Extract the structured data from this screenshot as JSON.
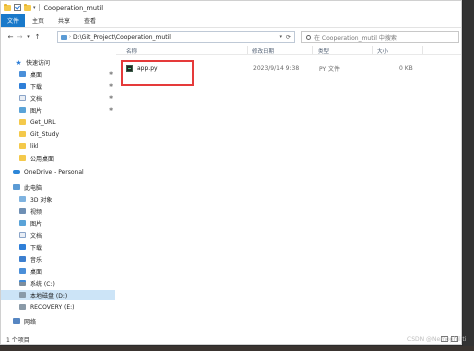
{
  "window": {
    "title": "Cooperation_mutil"
  },
  "ribbon": {
    "tabs": [
      "文件",
      "主页",
      "共享",
      "查看"
    ]
  },
  "address": {
    "path": "D:\\Git_Project\\Cooperation_mutil",
    "search_placeholder": "在 Cooperation_mutil 中搜索"
  },
  "nav": {
    "quick_access": "快速访问",
    "quick_items": [
      "桌面",
      "下载",
      "文档",
      "图片",
      "Get_URL",
      "Git_Study",
      "likl",
      "公用桌面"
    ],
    "onedrive": "OneDrive - Personal",
    "this_pc": "此电脑",
    "pc_items": [
      "3D 对象",
      "视频",
      "图片",
      "文档",
      "下载",
      "音乐",
      "桌面",
      "系统 (C:)",
      "本地磁盘 (D:)",
      "RECOVERY (E:)"
    ],
    "network": "网络"
  },
  "columns": {
    "name": "名称",
    "modified": "修改日期",
    "type": "类型",
    "size": "大小"
  },
  "files": [
    {
      "name": "app.py",
      "modified": "2023/9/14 9:38",
      "type": "PY 文件",
      "size": "0 KB"
    }
  ],
  "status": {
    "count": "1 个项目"
  },
  "watermark": "CSDN @Nemophiliti",
  "colors": {
    "accent": "#1979ca",
    "selection": "#cce4f7",
    "highlight_box": "#e53a3a"
  }
}
